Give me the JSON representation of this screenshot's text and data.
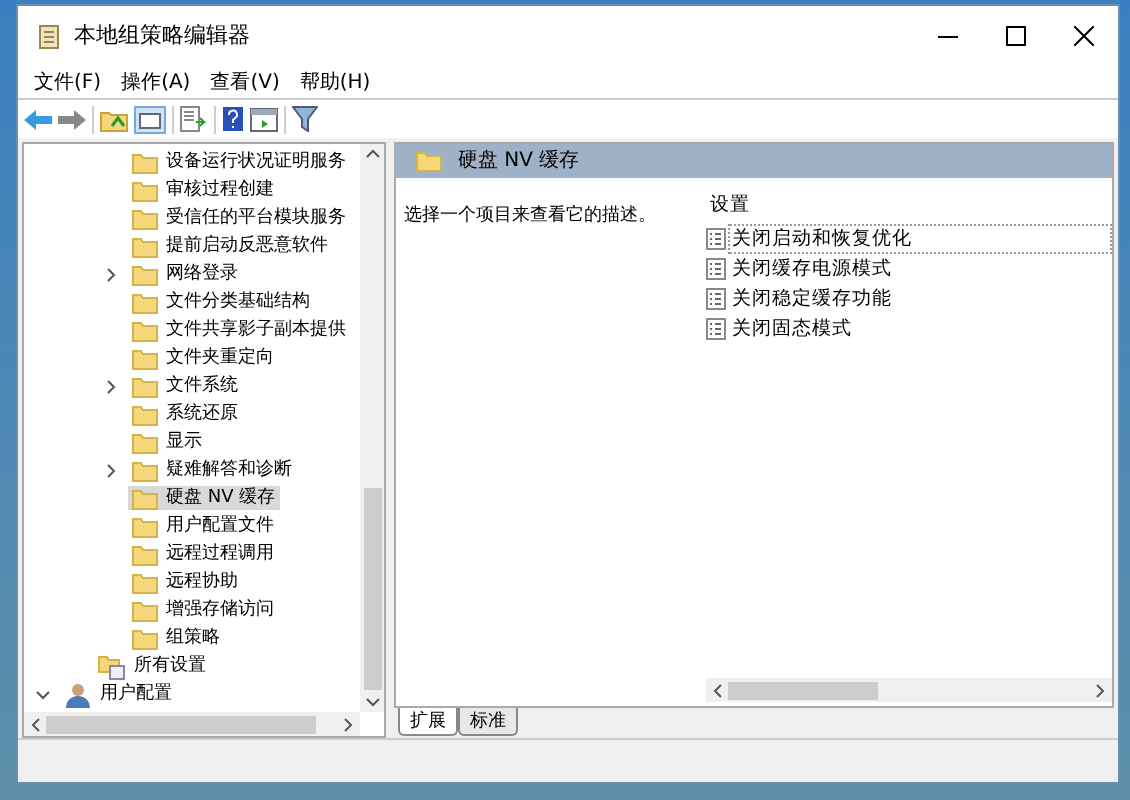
{
  "window": {
    "title": "本地组策略编辑器"
  },
  "menu": [
    "文件(F)",
    "操作(A)",
    "查看(V)",
    "帮助(H)"
  ],
  "tree": [
    {
      "children": [
        {
          "children": [
            {
              "label": "设备运行状况证明服务",
              "arrow": false,
              "selected": false
            },
            {
              "label": "审核过程创建",
              "arrow": false,
              "selected": false
            },
            {
              "label": "受信任的平台模块服务",
              "arrow": false,
              "selected": false
            },
            {
              "label": "提前启动反恶意软件",
              "arrow": false,
              "selected": false
            },
            {
              "label": "网络登录",
              "arrow": true,
              "selected": false
            },
            {
              "label": "文件分类基础结构",
              "arrow": false,
              "selected": false
            },
            {
              "label": "文件共享影子副本提供",
              "arrow": false,
              "selected": false
            },
            {
              "label": "文件夹重定向",
              "arrow": false,
              "selected": false
            },
            {
              "label": "文件系统",
              "arrow": true,
              "selected": false
            },
            {
              "label": "系统还原",
              "arrow": false,
              "selected": false
            },
            {
              "label": "显示",
              "arrow": false,
              "selected": false
            },
            {
              "label": "疑难解答和诊断",
              "arrow": true,
              "selected": false
            },
            {
              "label": "硬盘 NV 缓存",
              "arrow": false,
              "selected": true
            },
            {
              "label": "用户配置文件",
              "arrow": false,
              "selected": false
            },
            {
              "label": "远程过程调用",
              "arrow": false,
              "selected": false
            },
            {
              "label": "远程协助",
              "arrow": false,
              "selected": false
            },
            {
              "label": "增强存储访问",
              "arrow": false,
              "selected": false
            },
            {
              "label": "组策略",
              "arrow": false,
              "selected": false
            }
          ]
        },
        {
          "label": "所有设置",
          "kind": "settings",
          "arrow": false,
          "selected": false
        }
      ]
    },
    {
      "label": "用户配置",
      "kind": "user",
      "expanded": true,
      "arrow": true,
      "selected": false
    }
  ],
  "details": {
    "title": "硬盘 NV 缓存",
    "description": "选择一个项目来查看它的描述。",
    "column": "设置",
    "settings": [
      {
        "label": "关闭启动和恢复优化",
        "selected": true
      },
      {
        "label": "关闭缓存电源模式",
        "selected": false
      },
      {
        "label": "关闭稳定缓存功能",
        "selected": false
      },
      {
        "label": "关闭固态模式",
        "selected": false
      }
    ]
  },
  "tabs": [
    {
      "label": "扩展",
      "selected": true
    },
    {
      "label": "标准",
      "selected": false
    }
  ]
}
